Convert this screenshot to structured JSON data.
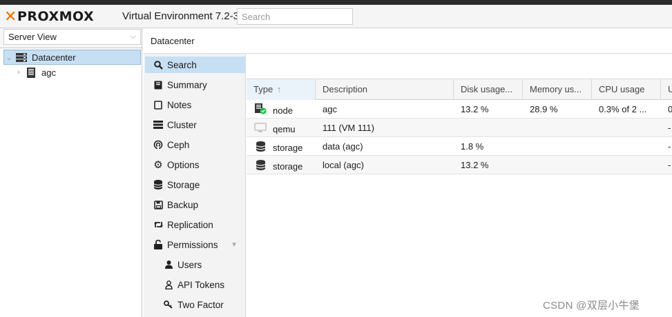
{
  "header": {
    "logo": "PROXMOX",
    "version": "Virtual Environment 7.2-3",
    "search_placeholder": "Search"
  },
  "left": {
    "view_select": "Server View",
    "tree": [
      {
        "label": "Datacenter",
        "icon": "server-rack-icon",
        "selected": true
      },
      {
        "label": "agc",
        "icon": "node-icon",
        "selected": false
      }
    ]
  },
  "content": {
    "title": "Datacenter"
  },
  "nav": {
    "items": [
      {
        "label": "Search",
        "icon": "search-icon",
        "selected": true
      },
      {
        "label": "Summary",
        "icon": "book-icon"
      },
      {
        "label": "Notes",
        "icon": "notes-icon"
      },
      {
        "label": "Cluster",
        "icon": "cluster-icon"
      },
      {
        "label": "Ceph",
        "icon": "ceph-icon"
      },
      {
        "label": "Options",
        "icon": "gear-icon"
      },
      {
        "label": "Storage",
        "icon": "database-icon"
      },
      {
        "label": "Backup",
        "icon": "floppy-icon"
      },
      {
        "label": "Replication",
        "icon": "retweet-icon"
      },
      {
        "label": "Permissions",
        "icon": "unlock-icon",
        "expanded": true
      },
      {
        "label": "Users",
        "icon": "user-icon",
        "sub": true
      },
      {
        "label": "API Tokens",
        "icon": "user-outline-icon",
        "sub": true
      },
      {
        "label": "Two Factor",
        "icon": "key-icon",
        "sub": true
      }
    ]
  },
  "grid": {
    "columns": [
      "Type",
      "Description",
      "Disk usage...",
      "Memory us...",
      "CPU usage",
      "U"
    ],
    "sort_indicator": "↑",
    "rows": [
      {
        "type": "node",
        "icon": "node-online-icon",
        "description": "agc",
        "disk": "13.2 %",
        "memory": "28.9 %",
        "cpu": "0.3% of 2 ...",
        "uptime": "0"
      },
      {
        "type": "qemu",
        "icon": "monitor-icon",
        "description": "111 (VM 111)",
        "disk": "",
        "memory": "",
        "cpu": "",
        "uptime": "-"
      },
      {
        "type": "storage",
        "icon": "database-icon",
        "description": "data (agc)",
        "disk": "1.8 %",
        "memory": "",
        "cpu": "",
        "uptime": "-"
      },
      {
        "type": "storage",
        "icon": "database-icon",
        "description": "local (agc)",
        "disk": "13.2 %",
        "memory": "",
        "cpu": "",
        "uptime": "-"
      }
    ]
  },
  "watermark": "CSDN @双层小牛堡",
  "colors": {
    "accent_orange": "#e57000",
    "selection_blue": "#c6dff3",
    "status_green": "#21bf4b"
  }
}
